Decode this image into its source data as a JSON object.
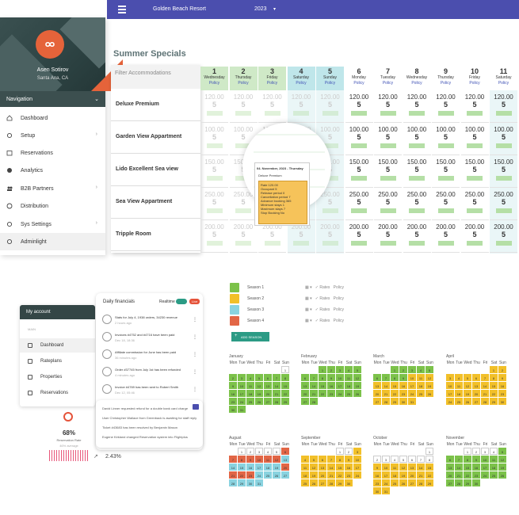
{
  "topbar": {
    "title": "Golden Beach Resort",
    "year": "2023"
  },
  "sidebar": {
    "user_name": "Asen Sotirov",
    "user_location": "Santa Ana, CA",
    "nav_label": "Navigation",
    "items": [
      {
        "label": "Dashboard",
        "icon": "home-icon"
      },
      {
        "label": "Setup",
        "icon": "gear-icon"
      },
      {
        "label": "Reservations",
        "icon": "calendar-icon"
      },
      {
        "label": "Analytics",
        "icon": "pie-icon"
      },
      {
        "label": "B2B Partners",
        "icon": "users-icon"
      },
      {
        "label": "Distribution",
        "icon": "globe-icon"
      },
      {
        "label": "Sys Settings",
        "icon": "gear-icon"
      },
      {
        "label": "Adminlight",
        "icon": "gear-icon"
      }
    ]
  },
  "rates": {
    "title": "Summer Specials",
    "filter_placeholder": "Filter Accommodations",
    "accommodations": [
      "Deluxe Premium",
      "Garden View Appartment",
      "Lido Excellent Sea view",
      "Sea View Appartment",
      "Tripple Room"
    ],
    "days": [
      {
        "num": "1",
        "wd": "Wednesday",
        "pol": "Policy"
      },
      {
        "num": "2",
        "wd": "Thursday",
        "pol": "Policy"
      },
      {
        "num": "3",
        "wd": "Friday",
        "pol": "Policy"
      },
      {
        "num": "4",
        "wd": "Saturday",
        "pol": "Policy"
      },
      {
        "num": "5",
        "wd": "Sunday",
        "pol": "Policy"
      },
      {
        "num": "6",
        "wd": "Monday",
        "pol": "Policy"
      },
      {
        "num": "7",
        "wd": "Tuesday",
        "pol": "Policy"
      },
      {
        "num": "8",
        "wd": "Wednesday",
        "pol": "Policy"
      },
      {
        "num": "9",
        "wd": "Thursday",
        "pol": "Policy"
      },
      {
        "num": "10",
        "wd": "Friday",
        "pol": "Policy"
      },
      {
        "num": "11",
        "wd": "Saturday",
        "pol": "Policy"
      }
    ],
    "prices": [
      "120.00",
      "100.00",
      "150.00",
      "250.00",
      "200.00"
    ],
    "qty": "5"
  },
  "tooltip": {
    "date": "04. November, 2023 - Thursday",
    "room": "Deluxe Premium",
    "lines": [
      "Rate 120.00",
      "Occupant 5",
      "Release period 0",
      "Cancellation period 7",
      "Advance booking 365",
      "Minimum stays 1",
      "Maximum stays 7",
      "Stop Booking No"
    ]
  },
  "account": {
    "title": "My account",
    "section": "MAIN",
    "items": [
      "Dashboard",
      "Rateplans",
      "Properties",
      "Reservations"
    ]
  },
  "financials": {
    "title": "Daily financials",
    "realtime": "Realtime",
    "live": "Live",
    "rows": [
      {
        "text": "Stats for July 4, 1938 orders, 34230 revenue",
        "time": "2 hours ago"
      },
      {
        "text": "Invoices #4752 and #4716 have been paid",
        "time": "Dec 18, 18:36"
      },
      {
        "text": "Affiliate commission for June has been paid",
        "time": "36 minutes ago"
      },
      {
        "text": "Order #37745 from July 1st has been refunded",
        "time": "4 minutes ago"
      },
      {
        "text": "Invoice #4769 has been sent to Robert Smith",
        "time": "Dec 12, 05:46"
      }
    ],
    "activity": [
      "David Linner requested refund for a double bank card charge",
      "User Christopher Wallace from Greenback is awaiting for staff reply",
      "Ticket #43683 has been resolved by Benjamin Mason",
      "Eugene Kirkland changed Reservation system into Flightplus"
    ],
    "stat_value": "68%",
    "stat_label": "Reservation Rate",
    "stat_sub": "46% average",
    "trend_value": "2.43%"
  },
  "seasons": {
    "items": [
      {
        "name": "Season 1",
        "color": "#7cc24a"
      },
      {
        "name": "Season 2",
        "color": "#f2c029"
      },
      {
        "name": "Season 3",
        "color": "#8ad3e0"
      },
      {
        "name": "Season 4",
        "color": "#e26646"
      }
    ],
    "rates_label": "Rates",
    "policy_label": "Policy",
    "add_label": "ADD SEASON"
  },
  "weekdays": [
    "Mon",
    "Tue",
    "Wed",
    "Thu",
    "Fri",
    "Sat",
    "Sun"
  ],
  "months": [
    {
      "name": "January"
    },
    {
      "name": "February"
    },
    {
      "name": "March"
    },
    {
      "name": "April"
    },
    {
      "name": "August"
    },
    {
      "name": "September"
    },
    {
      "name": "October"
    },
    {
      "name": "November"
    }
  ],
  "colors": {
    "topbar": "#4b4eae",
    "accent": "#e5633a",
    "sidebar_dark": "#344646",
    "green": "#7cc24a",
    "yellow": "#f2c029",
    "cyan": "#8ad3e0",
    "red": "#e26646"
  }
}
